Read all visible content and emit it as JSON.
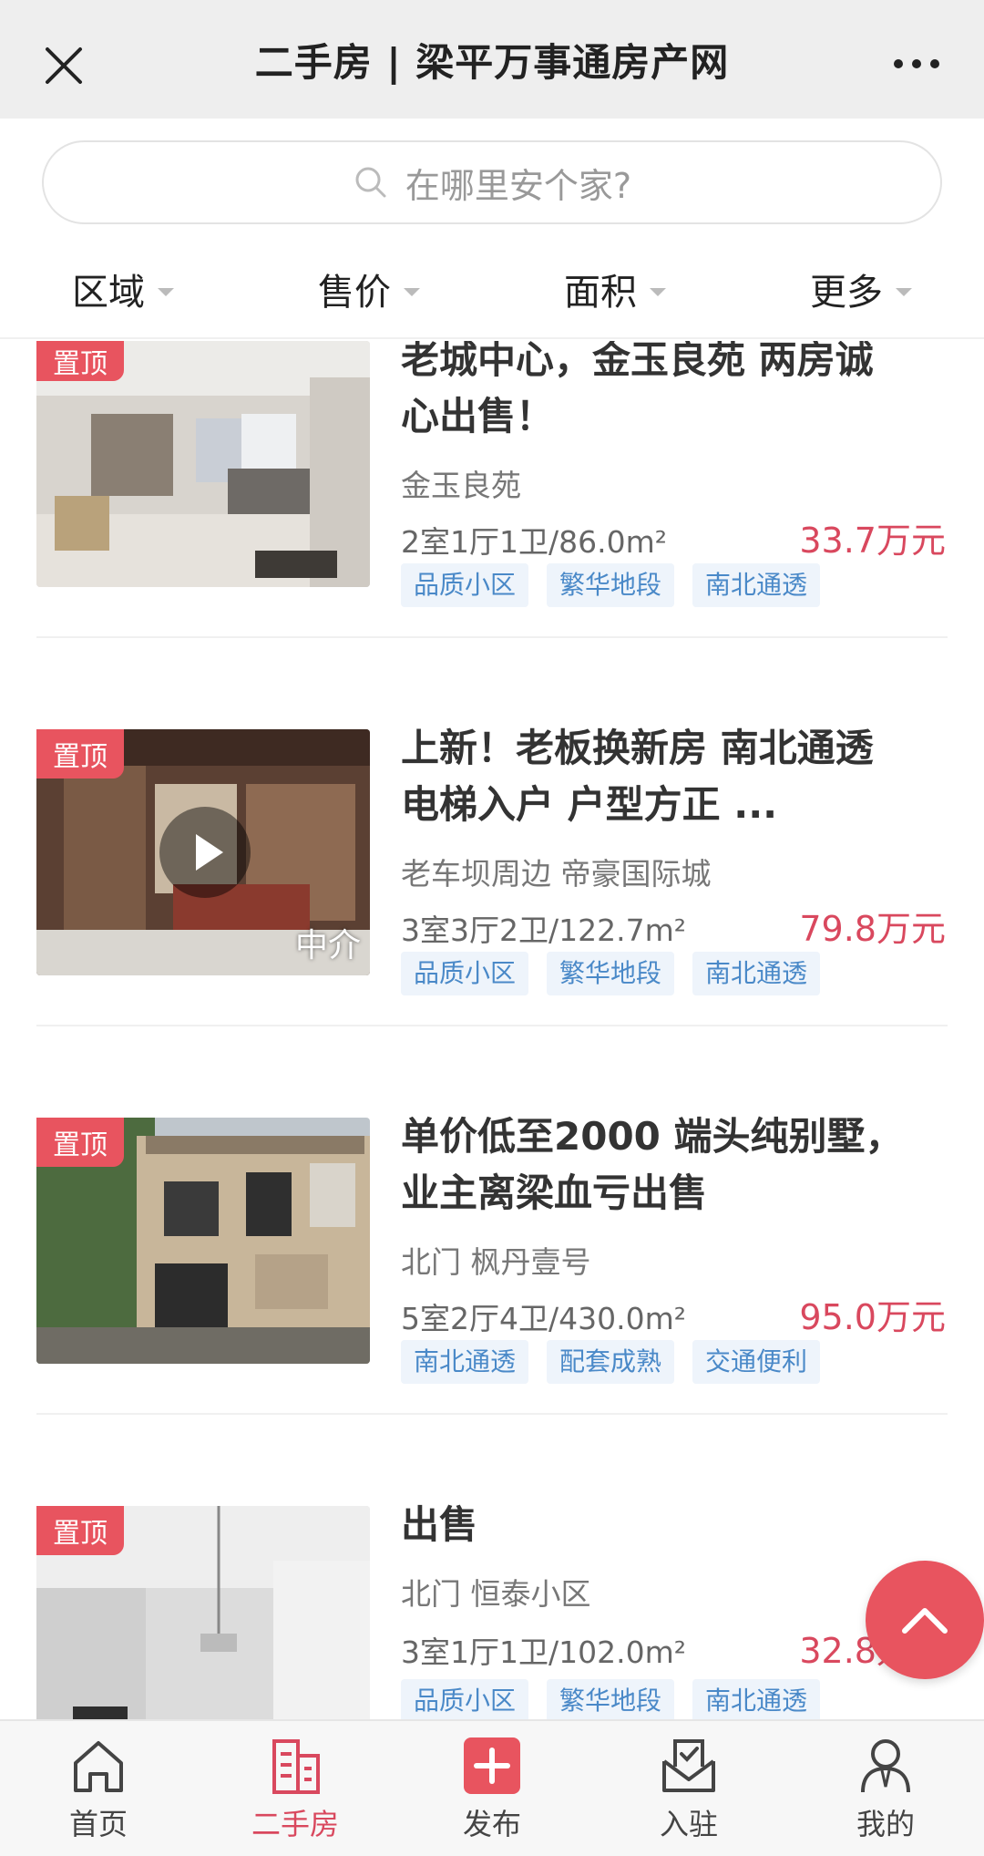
{
  "header": {
    "title": "二手房 | 梁平万事通房产网"
  },
  "search": {
    "placeholder": "在哪里安个家?"
  },
  "filters": [
    "区域",
    "售价",
    "面积",
    "更多"
  ],
  "pin_label": "置顶",
  "listings": [
    {
      "title_lines": [
        "老城中心，金玉良苑 两房诚",
        "心出售！"
      ],
      "location": "金玉良苑",
      "spec": "2室1厅1卫/86.0m²",
      "price": "33.7万元",
      "tags": [
        "品质小区",
        "繁华地段",
        "南北通透"
      ]
    },
    {
      "title_lines": [
        "上新！老板换新房 南北通透",
        "电梯入户 户型方正 ..."
      ],
      "location": "老车坝周边 帝豪国际城",
      "spec": "3室3厅2卫/122.7m²",
      "price": "79.8万元",
      "tags": [
        "品质小区",
        "繁华地段",
        "南北通透"
      ],
      "watermark": "中介"
    },
    {
      "title_lines": [
        "单价低至2000 端头纯别墅，",
        "业主离梁血亏出售"
      ],
      "location": "北门 枫丹壹号",
      "spec": "5室2厅4卫/430.0m²",
      "price": "95.0万元",
      "tags": [
        "南北通透",
        "配套成熟",
        "交通便利"
      ]
    },
    {
      "title_lines": [
        "出售"
      ],
      "location": "北门 恒泰小区",
      "spec": "3室1厅1卫/102.0m²",
      "price": "32.8万元",
      "tags": [
        "品质小区",
        "繁华地段",
        "南北通透"
      ]
    }
  ],
  "bottom_nav": [
    {
      "label": "首页",
      "icon": "home-icon"
    },
    {
      "label": "二手房",
      "icon": "building-icon",
      "active": true
    },
    {
      "label": "发布",
      "icon": "plus-icon"
    },
    {
      "label": "入驻",
      "icon": "inbox-icon"
    },
    {
      "label": "我的",
      "icon": "user-icon"
    }
  ],
  "colors": {
    "accent": "#d9485e",
    "tag_text": "#4a89c8",
    "tag_bg": "#eef4fb"
  }
}
